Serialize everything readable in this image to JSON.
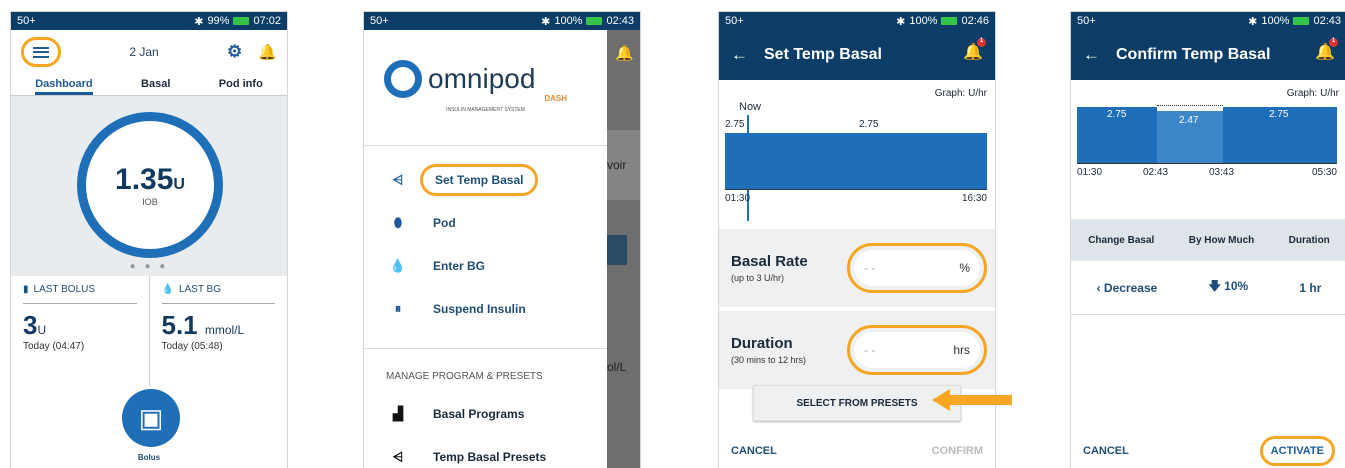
{
  "s1": {
    "status": {
      "signal": "50+",
      "battery": "99%",
      "time": "07:02"
    },
    "date": "2 Jan",
    "tabs": [
      "Dashboard",
      "Basal",
      "Pod info"
    ],
    "iob_value": "1.35",
    "iob_unit": "U",
    "iob_label": "IOB",
    "last_bolus": {
      "label": "LAST BOLUS",
      "value": "3",
      "unit": "U",
      "time": "Today (04:47)"
    },
    "last_bg": {
      "label": "LAST BG",
      "value": "5.1",
      "unit": "mmol/L",
      "time": "Today (05:48)"
    },
    "bolus_label": "Bolus"
  },
  "s2": {
    "status": {
      "signal": "50+",
      "battery": "100%",
      "time": "02:43"
    },
    "logo": {
      "brand": "omnipod",
      "sub": "DASH",
      "tagline": "INSULIN MANAGEMENT SYSTEM"
    },
    "menu": [
      "Set Temp Basal",
      "Pod",
      "Enter BG",
      "Suspend Insulin"
    ],
    "section": "MANAGE PROGRAM & PRESETS",
    "menu2": [
      "Basal Programs",
      "Temp Basal Presets"
    ],
    "behind": [
      "voir",
      "ol/L"
    ]
  },
  "s3": {
    "status": {
      "signal": "50+",
      "battery": "100%",
      "time": "02:46"
    },
    "title": "Set Temp Basal",
    "graph_label": "Graph: U/hr",
    "now": "Now",
    "rate_left": "2.75",
    "rate_mid": "2.75",
    "t_start": "01:30",
    "t_end": "16:30",
    "basal_rate": {
      "title": "Basal Rate",
      "sub": "(up to 3 U/hr)",
      "placeholder": "- -",
      "unit": "%"
    },
    "duration": {
      "title": "Duration",
      "sub": "(30 mins to 12 hrs)",
      "placeholder": "- -",
      "unit": "hrs"
    },
    "presets_btn": "SELECT FROM PRESETS",
    "cancel": "CANCEL",
    "confirm": "CONFIRM",
    "badge": "1"
  },
  "s4": {
    "status": {
      "signal": "50+",
      "battery": "100%",
      "time": "02:43"
    },
    "title": "Confirm Temp Basal",
    "graph_label": "Graph: U/hr",
    "rates": [
      "2.75",
      "2.47",
      "2.75"
    ],
    "times": [
      "01:30",
      "02:43",
      "03:43",
      "05:30"
    ],
    "headers": [
      "Change Basal",
      "By How Much",
      "Duration"
    ],
    "change": "Decrease",
    "amount": "10%",
    "duration": "1 hr",
    "cancel": "CANCEL",
    "activate": "ACTIVATE",
    "badge": "1"
  },
  "colors": {
    "primary": "#1e6fb8",
    "header": "#0b3d66",
    "highlight": "#f5a623",
    "battery": "#35c44a"
  }
}
